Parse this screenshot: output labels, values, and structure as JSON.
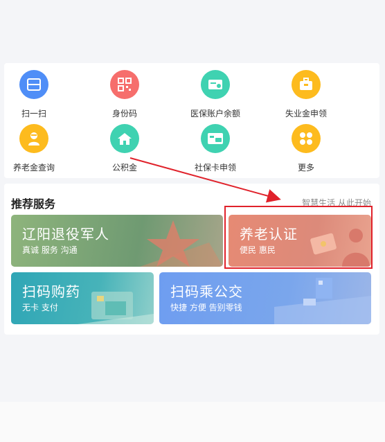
{
  "services": [
    {
      "label": "扫一扫",
      "icon": "scan-icon",
      "color": "#4f8ef7"
    },
    {
      "label": "身份码",
      "icon": "qr-code-icon",
      "color": "#f66e6c"
    },
    {
      "label": "医保账户余额",
      "icon": "medical-card-icon",
      "color": "#3fd2b1"
    },
    {
      "label": "失业金申领",
      "icon": "briefcase-icon",
      "color": "#fdbb1e"
    },
    {
      "label": "养老金查询",
      "icon": "elder-person-icon",
      "color": "#fdbb1e"
    },
    {
      "label": "公积金",
      "icon": "house-icon",
      "color": "#3fd2b1"
    },
    {
      "label": "社保卡申领",
      "icon": "si-card-icon",
      "color": "#3fd2b1"
    },
    {
      "label": "更多",
      "icon": "more-grid-icon",
      "color": "#fdbb1e"
    }
  ],
  "recommend": {
    "title": "推荐服务",
    "subtitle": "智慧生活 从此开始",
    "cards": [
      {
        "title": "辽阳退役军人",
        "sub": "真诚 服务 沟通"
      },
      {
        "title": "养老认证",
        "sub": "便民 惠民"
      },
      {
        "title": "扫码购药",
        "sub": "无卡 支付"
      },
      {
        "title": "扫码乘公交",
        "sub": "快捷 方便 告别零钱"
      }
    ]
  },
  "colors": {
    "highlight": "#e0222b",
    "card_veterans": "#7fa66f",
    "card_pension": "#e48a75",
    "card_medicine": "#3aa8b8",
    "card_bus": "#6e9df0"
  }
}
